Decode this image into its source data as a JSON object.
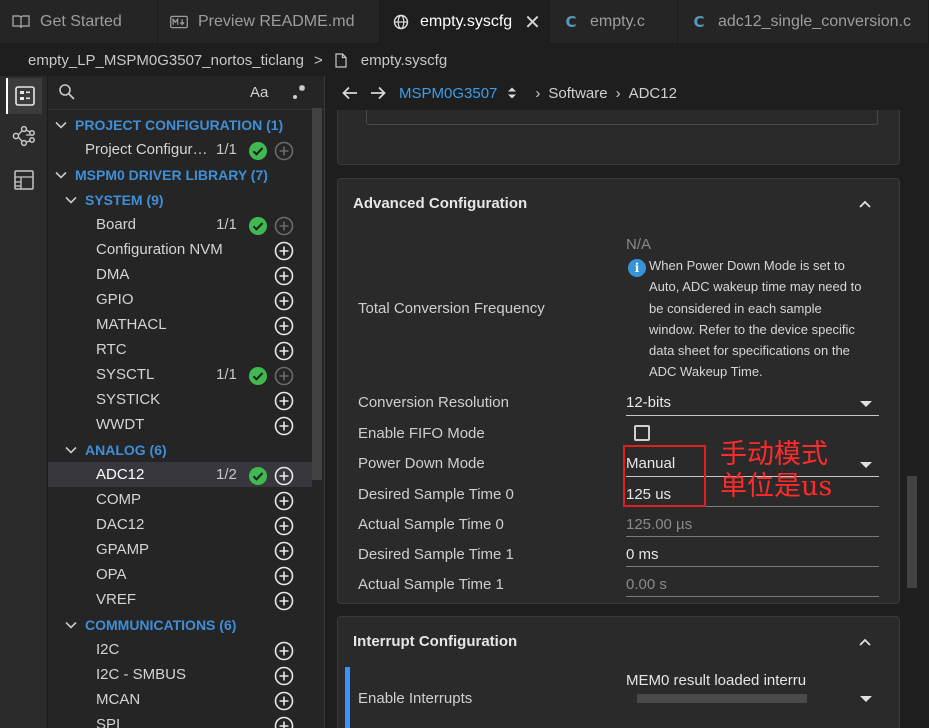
{
  "tabs": [
    {
      "label": "Get Started",
      "icon": "book-icon"
    },
    {
      "label": "Preview README.md",
      "icon": "markdown-icon"
    },
    {
      "label": "empty.syscfg",
      "icon": "globe-icon",
      "active": true
    },
    {
      "label": "empty.c",
      "icon": "c-file-icon"
    },
    {
      "label": "adc12_single_conversion.c",
      "icon": "c-file-icon"
    }
  ],
  "breadcrumb": {
    "project": "empty_LP_MSPM0G3507_nortos_ticlang",
    "file": "empty.syscfg",
    "separator": ">"
  },
  "panel": {
    "search_placeholder": "",
    "aa_label": "Aa"
  },
  "tree": {
    "project_config": {
      "label": "PROJECT CONFIGURATION (1)"
    },
    "project_item": {
      "label": "Project Configur…",
      "count": "1/1"
    },
    "driver_lib": {
      "label": "MSPM0 DRIVER LIBRARY (7)"
    },
    "system": {
      "label": "SYSTEM (9)"
    },
    "system_items": [
      {
        "label": "Board",
        "count": "1/1",
        "ok": true,
        "disabled_add": true
      },
      {
        "label": "Configuration NVM",
        "count": "",
        "ok": false
      },
      {
        "label": "DMA",
        "count": "",
        "ok": false
      },
      {
        "label": "GPIO",
        "count": "",
        "ok": false
      },
      {
        "label": "MATHACL",
        "count": "",
        "ok": false
      },
      {
        "label": "RTC",
        "count": "",
        "ok": false
      },
      {
        "label": "SYSCTL",
        "count": "1/1",
        "ok": true,
        "disabled_add": true
      },
      {
        "label": "SYSTICK",
        "count": "",
        "ok": false
      },
      {
        "label": "WWDT",
        "count": "",
        "ok": false
      }
    ],
    "analog": {
      "label": "ANALOG (6)"
    },
    "analog_items": [
      {
        "label": "ADC12",
        "count": "1/2",
        "ok": true,
        "selected": true
      },
      {
        "label": "COMP",
        "count": "",
        "ok": false
      },
      {
        "label": "DAC12",
        "count": "",
        "ok": false
      },
      {
        "label": "GPAMP",
        "count": "",
        "ok": false
      },
      {
        "label": "OPA",
        "count": "",
        "ok": false
      },
      {
        "label": "VREF",
        "count": "",
        "ok": false
      }
    ],
    "communications": {
      "label": "COMMUNICATIONS (6)"
    },
    "comm_items": [
      {
        "label": "I2C"
      },
      {
        "label": "I2C - SMBUS"
      },
      {
        "label": "MCAN"
      },
      {
        "label": "SPI"
      }
    ]
  },
  "nav": {
    "device": "MSPM0G3507",
    "crumb1": "Software",
    "crumb2": "ADC12",
    "separator": "›"
  },
  "advanced": {
    "title": "Advanced Configuration",
    "na": "N/A",
    "total_freq_label": "Total Conversion Frequency",
    "note_lines": [
      "When Power Down Mode is set to",
      "Auto, ADC wakeup time may need to",
      "be considered in each sample",
      "window. Refer to the device specific",
      "data sheet for specifications on the",
      "ADC Wakeup Time."
    ],
    "fields": {
      "resolution_label": "Conversion Resolution",
      "resolution_value": "12-bits",
      "fifo_label": "Enable FIFO Mode",
      "fifo_checked": false,
      "powerdown_label": "Power Down Mode",
      "powerdown_value": "Manual",
      "ds0_label": "Desired Sample Time 0",
      "ds0_value": "125 us",
      "as0_label": "Actual Sample Time 0",
      "as0_value": "125.00 µs",
      "ds1_label": "Desired Sample Time 1",
      "ds1_value": "0 ms",
      "as1_label": "Actual Sample Time 1",
      "as1_value": "0.00 s"
    }
  },
  "annotation": {
    "line1": "手动模式",
    "line2": "单位是us",
    "color": "#ff2a2a"
  },
  "interrupt": {
    "title": "Interrupt Configuration",
    "enable_label": "Enable Interrupts",
    "enable_value": "MEM0 result loaded interru"
  },
  "colors": {
    "accent_blue": "#3794ff",
    "header_blue": "#3f8fd8",
    "ok_green": "#3fb950",
    "annotation_red": "#e02020"
  }
}
